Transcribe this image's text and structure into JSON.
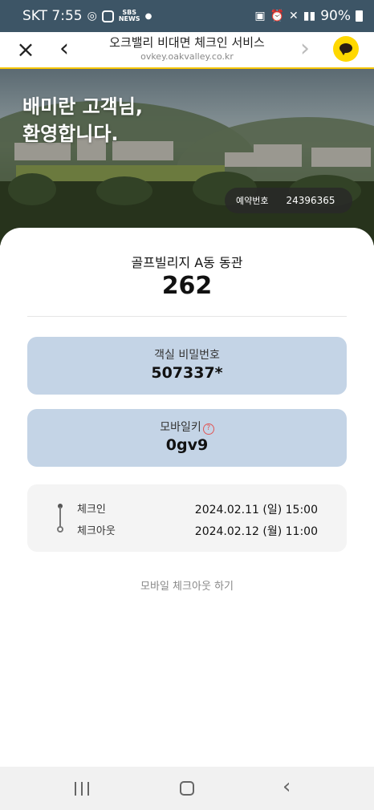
{
  "status_bar": {
    "carrier_time": "SKT 7:55",
    "news_badge": "SBS\nNEWS",
    "battery": "90%"
  },
  "browser": {
    "title": "오크밸리 비대면 체크인 서비스",
    "url": "ovkey.oakvalley.co.kr",
    "close_icon": "close-icon",
    "back_icon": "chevron-left-icon",
    "forward_icon": "chevron-right-icon",
    "share_icon": "kakaotalk-icon"
  },
  "hero": {
    "greeting_line1": "배미란 고객님,",
    "greeting_line2": "환영합니다.",
    "reservation_label": "예약번호",
    "reservation_number": "24396365"
  },
  "room": {
    "building": "골프빌리지 A동 동관",
    "number": "262"
  },
  "room_password": {
    "label": "객실 비밀번호",
    "value": "507337*"
  },
  "mobile_key": {
    "label": "모바일키",
    "value": "0gv9",
    "help_icon": "question-circle-icon"
  },
  "schedule": {
    "checkin_label": "체크인",
    "checkin_value": "2024.02.11 (일) 15:00",
    "checkout_label": "체크아웃",
    "checkout_value": "2024.02.12 (월) 11:00"
  },
  "actions": {
    "mobile_checkout": "모바일 체크아웃 하기"
  },
  "colors": {
    "accent_yellow": "#f5c400",
    "box_blue": "#c4d4e6",
    "kakao_yellow": "#ffd800"
  }
}
